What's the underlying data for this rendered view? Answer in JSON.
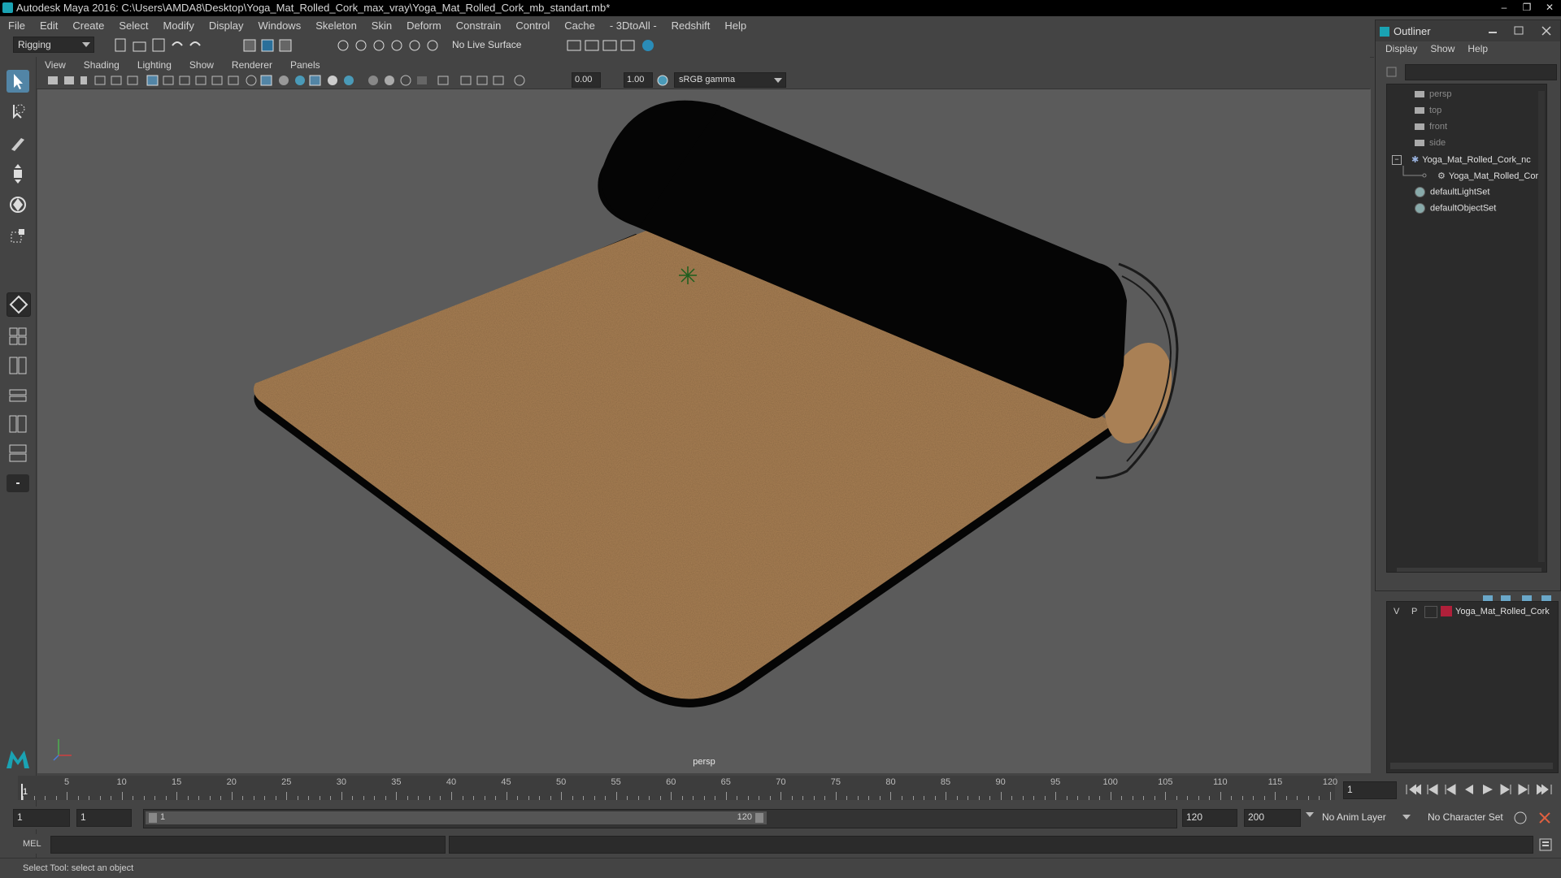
{
  "window": {
    "title": "Autodesk Maya 2016: C:\\Users\\AMDA8\\Desktop\\Yoga_Mat_Rolled_Cork_max_vray\\Yoga_Mat_Rolled_Cork_mb_standart.mb*",
    "controls": [
      "–",
      "❐",
      "✕"
    ]
  },
  "menubar": [
    "File",
    "Edit",
    "Create",
    "Select",
    "Modify",
    "Display",
    "Windows",
    "Skeleton",
    "Skin",
    "Deform",
    "Constrain",
    "Control",
    "Cache",
    "- 3DtoAll -",
    "Redshift",
    "Help"
  ],
  "statusline": {
    "mode": "Rigging",
    "live_surface": "No Live Surface"
  },
  "panel": {
    "menus": [
      "View",
      "Shading",
      "Lighting",
      "Show",
      "Renderer",
      "Panels"
    ],
    "exposure": "0.00",
    "gamma": "1.00",
    "colorspace": "sRGB gamma",
    "camera_label": "persp"
  },
  "outliner": {
    "title": "Outliner",
    "menus": [
      "Display",
      "Show",
      "Help"
    ],
    "items": [
      {
        "label": "persp",
        "type": "camera"
      },
      {
        "label": "top",
        "type": "camera"
      },
      {
        "label": "front",
        "type": "camera"
      },
      {
        "label": "side",
        "type": "camera"
      },
      {
        "label": "Yoga_Mat_Rolled_Cork_nc",
        "type": "group"
      },
      {
        "label": "Yoga_Mat_Rolled_Cork",
        "type": "mesh"
      },
      {
        "label": "defaultLightSet",
        "type": "set"
      },
      {
        "label": "defaultObjectSet",
        "type": "set"
      }
    ]
  },
  "layers": {
    "v": "V",
    "p": "P",
    "layer_name": "Yoga_Mat_Rolled_Cork",
    "layer_color": "#b0203a"
  },
  "timeslider": {
    "start": 1,
    "end": 120,
    "labels": [
      "5",
      "10",
      "15",
      "20",
      "25",
      "30",
      "35",
      "40",
      "45",
      "50",
      "55",
      "60",
      "65",
      "70",
      "75",
      "80",
      "85",
      "90",
      "95",
      "100",
      "105",
      "110",
      "115",
      "120"
    ],
    "current_frame": "1",
    "current_marker": "1"
  },
  "range": {
    "start_field": "1",
    "playback_start": "1",
    "slider_start": "1",
    "slider_end": "120",
    "playback_end": "120",
    "end_field": "200",
    "anim_layer": "No Anim Layer",
    "character_set": "No Character Set"
  },
  "cmdline": {
    "lang": "MEL"
  },
  "helpline": {
    "text": "Select Tool: select an object"
  },
  "colors": {
    "cork": "#a98055",
    "mat_black": "#050505",
    "viewport_bg": "#5b5b5b",
    "accent": "#1aa3b3"
  }
}
